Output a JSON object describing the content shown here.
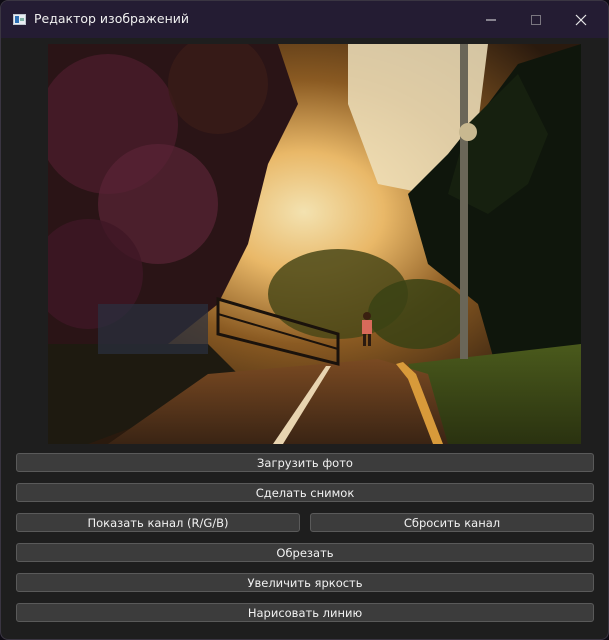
{
  "window": {
    "title": "Редактор изображений"
  },
  "photo": {
    "subject": "sunset park path with a runner, trees and a lamp post"
  },
  "buttons": {
    "load_photo": "Загрузить фото",
    "take_snapshot": "Сделать снимок",
    "show_channel": "Показать канал (R/G/B)",
    "reset_channel": "Сбросить канал",
    "crop": "Обрезать",
    "increase_brightness": "Увеличить яркость",
    "draw_line": "Нарисовать линию"
  },
  "colors": {
    "titlebar": "#241c33",
    "window_bg": "#1e1e1e",
    "button_bg": "#3c3c3c",
    "button_border": "#5a5a5a",
    "text": "#f2f2f2"
  }
}
